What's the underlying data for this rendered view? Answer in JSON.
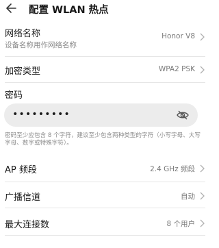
{
  "header": {
    "title": "配置 WLAN 热点"
  },
  "network_name": {
    "label": "网络名称",
    "sublabel": "设备名称用作网络名称",
    "value": "Honor V8"
  },
  "encryption": {
    "label": "加密类型",
    "value": "WPA2 PSK"
  },
  "password": {
    "label": "密码",
    "value": "•••••••••",
    "hint": "密码至少应包含 8 个字符，建议至少包含两种类型的字符（小写字母、大写字母、数字或特殊字符）。"
  },
  "ap_band": {
    "label": "AP 频段",
    "value": "2.4 GHz 频段"
  },
  "channel": {
    "label": "广播信道",
    "value": "自动"
  },
  "max_connections": {
    "label": "最大连接数",
    "value": "8 个用户"
  }
}
